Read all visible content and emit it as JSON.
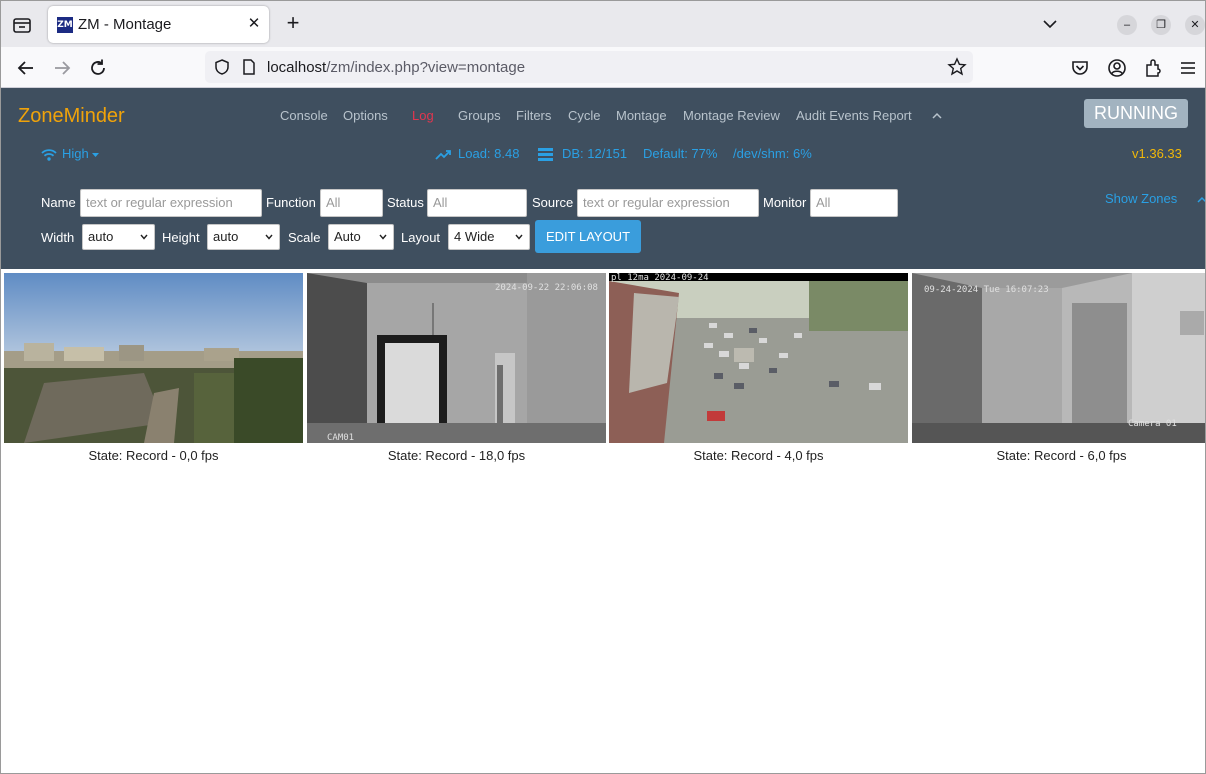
{
  "browser": {
    "tab_title": "ZM - Montage",
    "tab_favicon": "ZM",
    "url_host": "localhost",
    "url_path": "/zm/index.php?view=montage",
    "icons": [
      "tab-list-icon",
      "close-icon",
      "plus-icon",
      "chevron-down-icon",
      "minimize-icon",
      "restore-icon",
      "close-icon",
      "back-icon",
      "forward-icon",
      "reload-icon",
      "shield-icon",
      "page-icon",
      "star-icon",
      "pocket-icon",
      "account-icon",
      "extensions-icon",
      "menu-icon"
    ]
  },
  "zm": {
    "brand": "ZoneMinder",
    "menu": {
      "console": "Console",
      "options": "Options",
      "log": "Log",
      "groups": "Groups",
      "filters": "Filters",
      "cycle": "Cycle",
      "montage": "Montage",
      "montage_review": "Montage Review",
      "audit": "Audit Events Report"
    },
    "status_button": "RUNNING",
    "bandwidth": "High",
    "load": "Load: 8.48",
    "db": "DB: 12/151",
    "default_disk": "Default: 77%",
    "shm": "/dev/shm: 6%",
    "version": "v1.36.33",
    "colors": {
      "brand": "#f0a30a",
      "log": "#e2364f",
      "stat": "#2aa0e4",
      "version": "#f0b80a",
      "header_bg": "#3f4f5f"
    }
  },
  "filters": {
    "name_label": "Name",
    "name_placeholder": "text or regular expression",
    "function_label": "Function",
    "function_placeholder": "All",
    "status_label": "Status",
    "status_placeholder": "All",
    "source_label": "Source",
    "source_placeholder": "text or regular expression",
    "monitor_label": "Monitor",
    "monitor_placeholder": "All",
    "width_label": "Width",
    "width_value": "auto",
    "height_label": "Height",
    "height_value": "auto",
    "scale_label": "Scale",
    "scale_value": "Auto",
    "layout_label": "Layout",
    "layout_value": "4 Wide",
    "edit_layout": "EDIT LAYOUT",
    "show_zones": "Show Zones"
  },
  "monitors": [
    {
      "state": "State: Record - 0,0 fps",
      "osd": ""
    },
    {
      "state": "State: Record - 18,0 fps",
      "osd": "2024-09-22 22:06:08",
      "osd2": "CAM01"
    },
    {
      "state": "State: Record - 4,0 fps",
      "osd": "pl 12ma 2024-09-24"
    },
    {
      "state": "State: Record - 6,0 fps",
      "osd": "09-24-2024 Tue 16:07:23",
      "osd2": "Camera 01"
    }
  ]
}
